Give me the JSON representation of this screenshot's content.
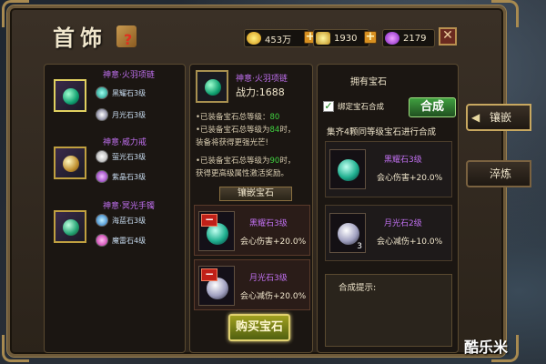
{
  "title": "首饰",
  "currencies": [
    {
      "name": "gold",
      "value": "453万",
      "color": "#e8c030"
    },
    {
      "name": "ingot",
      "value": "1930",
      "color": "#f0d040"
    },
    {
      "name": "diamond",
      "value": "2179",
      "color": "#c040e0"
    }
  ],
  "equipment": [
    {
      "name": "神意·火羽项链",
      "jewel_color": "#20c080",
      "gems": [
        {
          "label": "黑耀石3级",
          "color": "#30d0b0"
        },
        {
          "label": "月光石3级",
          "color": "#d0d0f0"
        }
      ]
    },
    {
      "name": "神意·威力戒",
      "jewel_color": "#e0c050",
      "gems": [
        {
          "label": "萤光石3级",
          "color": "#f0f0f0"
        },
        {
          "label": "紫晶石3级",
          "color": "#c060e0"
        }
      ]
    },
    {
      "name": "神意·冥光手镯",
      "jewel_color": "#30c080",
      "gems": [
        {
          "label": "海蓝石3级",
          "color": "#30b0e0"
        },
        {
          "label": "魔雷石4级",
          "color": "#e040c0"
        }
      ]
    }
  ],
  "selected": {
    "name": "神意·火羽项链",
    "power_label": "战力:",
    "power_value": "1688",
    "info": [
      {
        "pre": "•已装备宝石总等级：",
        "val": "80",
        "post": ""
      },
      {
        "pre": "•已装备宝石总等级为",
        "val": "84",
        "post": "时，"
      },
      {
        "pre": "  装备将获得更强光芒!",
        "val": "",
        "post": ""
      },
      {
        "pre": "•已装备宝石总等级为",
        "val": "90",
        "post": "时，"
      },
      {
        "pre": "  获得更高级属性激活奖励。",
        "val": "",
        "post": ""
      }
    ],
    "inlay_tag": "镶嵌宝石",
    "sockets": [
      {
        "name": "黑耀石3级",
        "stat": "会心伤害+20.0%",
        "color": "#30d0b0"
      },
      {
        "name": "月光石3级",
        "stat": "会心减伤+20.0%",
        "color": "#d0d0f0"
      }
    ],
    "buy_label": "购买宝石"
  },
  "owned": {
    "title": "拥有宝石",
    "bind_label": "绑定宝石合成",
    "compose_label": "合成",
    "compose_hint": "集齐4颗同等级宝石进行合成",
    "gems": [
      {
        "name": "黑耀石3级",
        "stat": "会心伤害+20.0%",
        "count": "",
        "color": "#30d0b0"
      },
      {
        "name": "月光石2级",
        "stat": "会心减伤+10.0%",
        "count": "3",
        "color": "#d0d0f0"
      }
    ],
    "hint_label": "合成提示:"
  },
  "side_tabs": [
    {
      "label": "镶嵌",
      "active": true
    },
    {
      "label": "淬炼",
      "active": false
    }
  ],
  "watermark": "酷乐米"
}
